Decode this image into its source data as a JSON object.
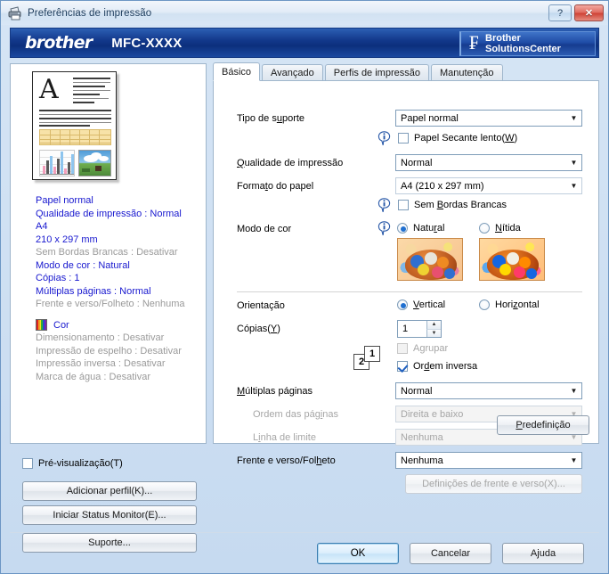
{
  "window": {
    "title": "Preferências de impressão",
    "title_icon": "printer-icon",
    "help_button": "?",
    "close_button": "✕"
  },
  "banner": {
    "logo": "brother",
    "model": "MFC-XXXX",
    "solutions_line1": "Brother",
    "solutions_line2": "SolutionsCenter"
  },
  "sidebar": {
    "summary_blue": [
      "Papel normal",
      "Qualidade de impressão : Normal",
      "A4",
      "210 x 297 mm"
    ],
    "summary_borderless": "Sem Bordas Brancas : Desativar",
    "summary_blue2": [
      "Modo de cor : Natural",
      "Cópias : 1",
      "Múltiplas páginas : Normal"
    ],
    "summary_duplex": "Frente e verso/Folheto : Nenhuma",
    "color_label": "Cor",
    "summary_gray": [
      "Dimensionamento : Desativar",
      "Impressão de espelho : Desativar",
      "Impressão inversa : Desativar",
      "Marca de água : Desativar"
    ],
    "preview_checkbox": "Pré-visualização(T)",
    "preview_checked": false,
    "buttons": [
      "Adicionar perfil(K)...",
      "Iniciar Status Monitor(E)...",
      "Suporte..."
    ]
  },
  "tabs": [
    {
      "label": "Básico",
      "active": true
    },
    {
      "label": "Avançado",
      "active": false
    },
    {
      "label": "Perfis de impressão",
      "active": false
    },
    {
      "label": "Manutenção",
      "active": false
    }
  ],
  "form": {
    "media_type_label": "Tipo de suporte",
    "media_type_value": "Papel normal",
    "slow_drying_label": "Papel Secante lento(W)",
    "slow_drying_checked": false,
    "print_quality_label": "Qualidade de impressão",
    "print_quality_value": "Normal",
    "paper_size_label": "Formato do papel",
    "paper_size_value": "A4 (210 x 297 mm)",
    "borderless_label": "Sem Bordas Brancas",
    "borderless_checked": false,
    "color_mode_label": "Modo de cor",
    "color_mode_natural": "Natural",
    "color_mode_vivid": "Nítida",
    "color_mode_selected": "Natural",
    "orientation_label": "Orientação",
    "orientation_portrait": "Vertical",
    "orientation_landscape": "Horizontal",
    "orientation_selected": "Vertical",
    "copies_label": "Cópias(Y)",
    "copies_value": "1",
    "collate_label": "Agrupar",
    "collate_checked": false,
    "collate_disabled": true,
    "reverse_order_label": "Ordem inversa",
    "reverse_order_checked": true,
    "page_order_icon_1": "1",
    "page_order_icon_2": "2",
    "multiple_pages_label": "Múltiplas páginas",
    "multiple_pages_value": "Normal",
    "page_order_label": "Ordem das páginas",
    "page_order_value": "Direita e baixo",
    "border_line_label": "Linha de limite",
    "border_line_value": "Nenhuma",
    "duplex_label": "Frente e verso/Folheto",
    "duplex_value": "Nenhuma",
    "duplex_settings_button": "Definições de frente e verso(X)...",
    "default_button": "Predefinição"
  },
  "dialog_buttons": {
    "ok": "OK",
    "cancel": "Cancelar",
    "help": "Ajuda"
  },
  "colors": {
    "accent_blue": "#1818cf",
    "banner_blue": "#13398c",
    "disabled_gray": "#9a9a9a"
  }
}
